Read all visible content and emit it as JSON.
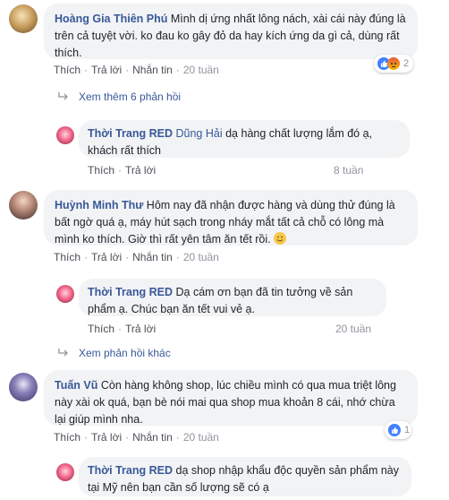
{
  "labels": {
    "like": "Thích",
    "reply": "Trả lời",
    "message": "Nhắn tin",
    "sep": "·"
  },
  "comments": [
    {
      "author": "Hoàng Gia Thiên Phú",
      "text": "Mình dị ứng nhất lông nách, xài cái này đúng là trên cả tuyệt vời. ko đau ko gây đỏ da hay kích ứng da gì cả, dùng rất thích.",
      "time": "20 tuần",
      "reaction_count": "2",
      "view_more": "Xem thêm 6 phản hồi"
    },
    {
      "author": "Thời Trang RED",
      "tag": "Dũng Hải",
      "text": "dạ hàng chất lượng lắm đó ạ, khách rất thích",
      "time": "8 tuần"
    },
    {
      "author": "Huỳnh Minh Thư",
      "text": "Hôm nay đã nhận được hàng và dùng thử đúng là bất ngờ quá ạ, máy hút sạch trong nháy mắt tất cả chỗ có lông mà mình ko thích. Giờ thì rất yên tâm ăn tết rồi.",
      "time": "20 tuần"
    },
    {
      "author": "Thời Trang RED",
      "text": "Dạ cám ơn bạn đã tin tưởng về sản phẩm ạ. Chúc bạn ăn tết vui vẻ ạ.",
      "time": "20 tuần",
      "view_more": "Xem phản hồi khác"
    },
    {
      "author": "Tuấn Vũ",
      "text": "Còn hàng không shop, lúc chiều mình có qua mua triệt lông này xài ok quá, bạn bè nói mai qua shop mua khoản 8 cái, nhớ chừa lại giúp mình nha.",
      "time": "20 tuần",
      "reaction_count": "1"
    },
    {
      "author": "Thời Trang RED",
      "text": "dạ shop nhập khẩu độc quyền sản phẩm này tại Mỹ nên bạn cần số lượng sẽ có ạ"
    }
  ],
  "colors": {
    "link": "#385898",
    "bubble": "#f2f3f5",
    "like": "#4080ff",
    "angry": "#f7714b"
  },
  "icons": [
    "like-reaction-icon",
    "angry-reaction-icon",
    "reply-arrow-icon",
    "smile-emoji-icon"
  ]
}
